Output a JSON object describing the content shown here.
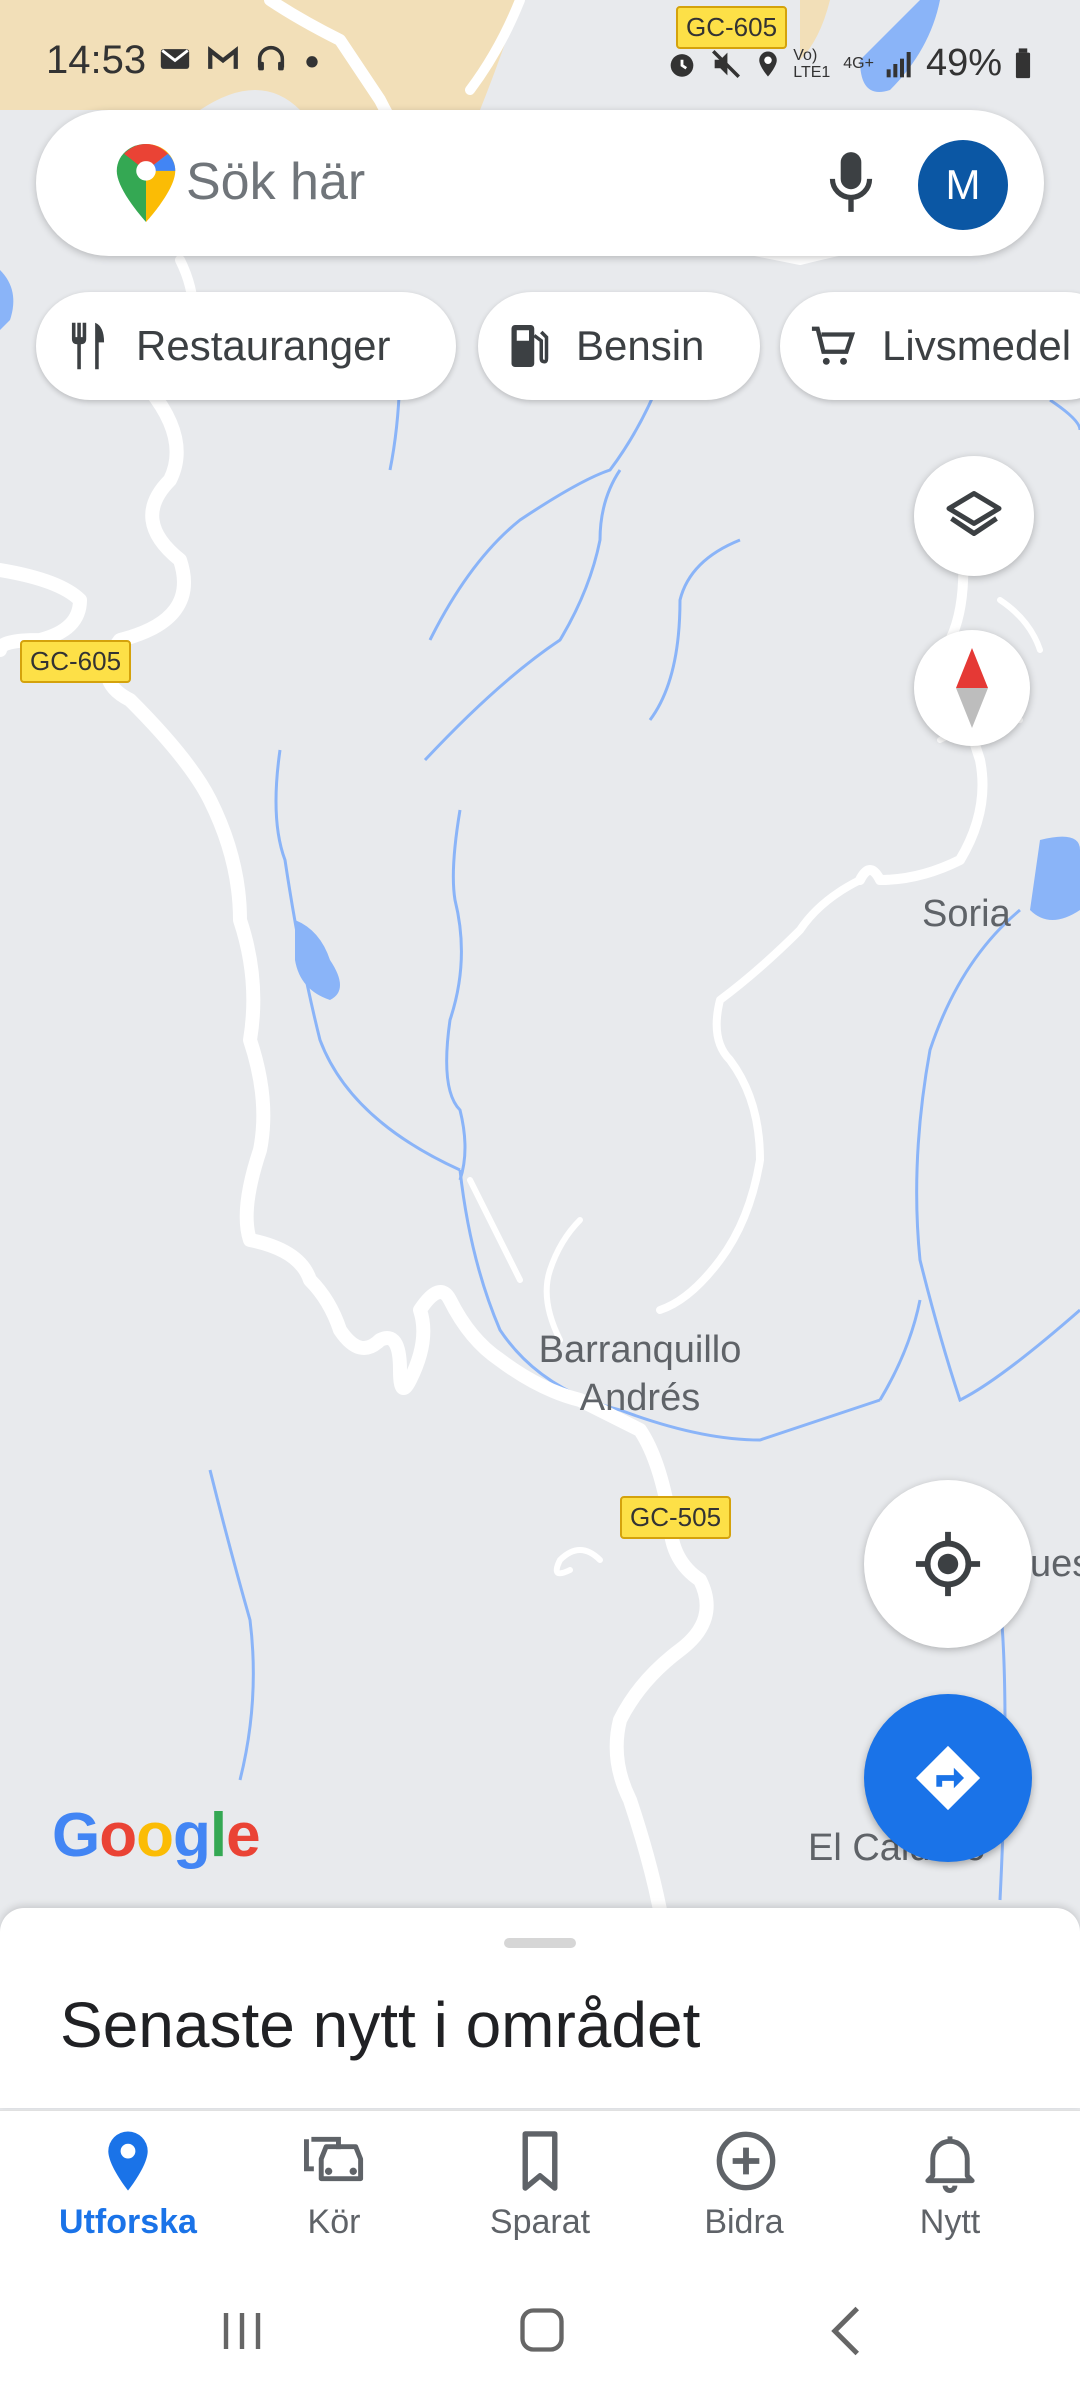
{
  "status_bar": {
    "time": "14:53",
    "battery": "49%",
    "network_lte": "Vo) LTE1",
    "network_4g": "4G+"
  },
  "search": {
    "placeholder": "Sök här",
    "avatar_letter": "M"
  },
  "chips": [
    {
      "label": "Restauranger",
      "icon": "restaurant-icon"
    },
    {
      "label": "Bensin",
      "icon": "gas-station-icon"
    },
    {
      "label": "Livsmedel",
      "icon": "cart-icon"
    }
  ],
  "map": {
    "places": {
      "soria": "Soria",
      "barranquillo_line1": "Barranquillo",
      "barranquillo_line2": "Andrés",
      "el_caidero": "El Caidero",
      "cut_label": "ues"
    },
    "roads": {
      "gc605_top": "GC-605",
      "gc605_left": "GC-605",
      "gc505": "GC-505"
    },
    "google_logo": "Google"
  },
  "sheet": {
    "title": "Senaste nytt i området"
  },
  "nav": {
    "items": [
      {
        "label": "Utforska",
        "icon": "explore-pin-icon",
        "active": true
      },
      {
        "label": "Kör",
        "icon": "car-icon",
        "active": false
      },
      {
        "label": "Sparat",
        "icon": "bookmark-icon",
        "active": false
      },
      {
        "label": "Bidra",
        "icon": "add-circle-icon",
        "active": false
      },
      {
        "label": "Nytt",
        "icon": "bell-icon",
        "active": false
      }
    ]
  },
  "colors": {
    "accent": "#1a73e8",
    "water": "#8ab4f8",
    "road_shield": "#fde047",
    "avatar": "#0b57a4"
  }
}
